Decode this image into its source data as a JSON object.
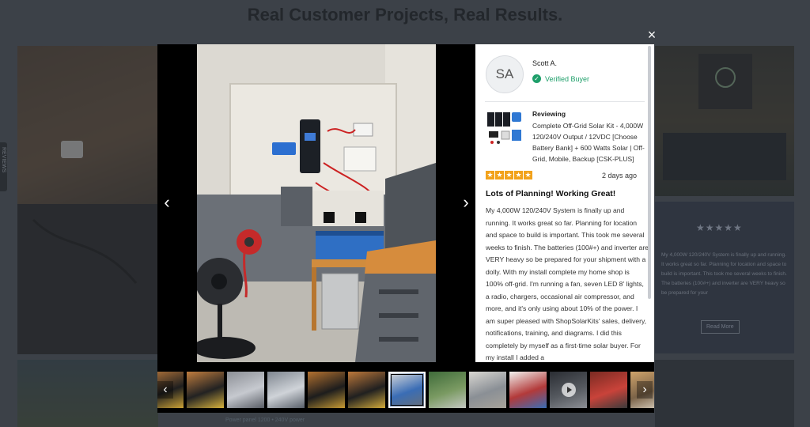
{
  "page": {
    "title": "Real Customer Projects, Real Results.",
    "side_tab_label": "REVIEWS",
    "bg_caption": "Power panel 1200 • 240V power",
    "bg_review": {
      "stars": "★★★★★",
      "text": "My 4,000W 120/240V System is finally up and running. It works great so far. Planning for location and space to build is important. This took me several weeks to finish. The batteries (100#+) and inverter are VERY heavy so be prepared for your",
      "read_more": "Read More"
    }
  },
  "modal": {
    "close_glyph": "×",
    "prev_glyph": "‹",
    "next_glyph": "›",
    "review": {
      "avatar_initials": "SA",
      "reviewer_name": "Scott A.",
      "verified_label": "Verified Buyer",
      "verified_glyph": "✓",
      "reviewing_label": "Reviewing",
      "product_name": "Complete Off-Grid Solar Kit - 4,000W 120/240V Output / 12VDC [Choose Battery Bank] + 600 Watts Solar | Off-Grid, Mobile, Backup [CSK-PLUS]",
      "rating": 5,
      "star_glyph": "★",
      "date": "2 days ago",
      "title": "Lots of Planning! Working Great!",
      "body": "My 4,000W 120/240V System is finally up and running. It works great so far. Planning for location and space to build is important. This took me several weeks to finish. The batteries (100#+) and inverter are VERY heavy so be prepared for your shipment with a dolly. With my install complete my home shop is 100% off-grid. I'm running a fan, seven LED 8' lights, a radio, chargers, occasional air compressor, and more, and it's only using about 10% of the power. I am super pleased with ShopSolarKits' sales, delivery, notifications, training, and diagrams. I did this completely by myself as a first-time solar buyer. For my install I added a"
    },
    "thumbnails": [
      {
        "kind": "cabinet",
        "colors": [
          "#b5763a",
          "#1f1f1f",
          "#c9a035"
        ]
      },
      {
        "kind": "cabinet",
        "colors": [
          "#c07d3e",
          "#222",
          "#d6b13c"
        ]
      },
      {
        "kind": "roof",
        "colors": [
          "#8c8f96",
          "#c6c9cf",
          "#5a5e66"
        ]
      },
      {
        "kind": "roof",
        "colors": [
          "#7f8690",
          "#cfd3d8",
          "#59606a"
        ]
      },
      {
        "kind": "cabinet",
        "colors": [
          "#b3712f",
          "#1d1d1d",
          "#c79a33"
        ]
      },
      {
        "kind": "cabinet",
        "colors": [
          "#bd783a",
          "#202020",
          "#d2aa3a"
        ]
      },
      {
        "kind": "active",
        "colors": [
          "#e3e1dc",
          "#3a6db5",
          "#6a6f75"
        ]
      },
      {
        "kind": "trees",
        "colors": [
          "#3f6b3a",
          "#7a9a62",
          "#c4c8c2"
        ]
      },
      {
        "kind": "garage",
        "colors": [
          "#d9d7d2",
          "#8a8f95",
          "#a7a39b"
        ]
      },
      {
        "kind": "diagram",
        "colors": [
          "#f1f1ee",
          "#b33a3a",
          "#3a6db5"
        ]
      },
      {
        "kind": "video",
        "colors": [
          "#2a2d33",
          "#55595f",
          "#8c8f95"
        ]
      },
      {
        "kind": "cables",
        "colors": [
          "#7a2a22",
          "#c9433a",
          "#3b3b3b"
        ]
      },
      {
        "kind": "garage",
        "colors": [
          "#cfa36b",
          "#7b6348",
          "#e0d8c8"
        ]
      }
    ]
  }
}
